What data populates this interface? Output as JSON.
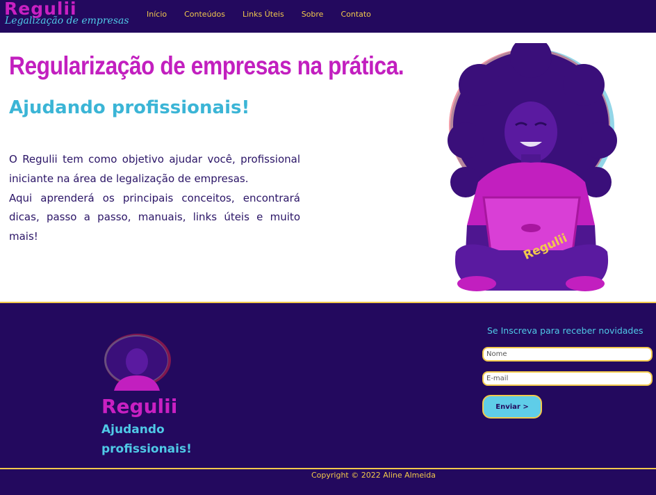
{
  "header": {
    "brand_title": "Regulii",
    "brand_subtitle": "Legalização de empresas",
    "nav": [
      {
        "label": "Início"
      },
      {
        "label": "Conteúdos"
      },
      {
        "label": "Links Úteis"
      },
      {
        "label": "Sobre"
      },
      {
        "label": "Contato"
      }
    ]
  },
  "hero": {
    "title": "Regularização de empresas na prática.",
    "subtitle": "Ajudando profissionais!",
    "paragraph_1": "O Regulii tem como objetivo ajudar você, profissional iniciante na área de legalização de empresas.",
    "paragraph_2": "Aqui aprenderá os principais conceitos, encontrará dicas, passo a passo, manuais, links úteis e muito mais!",
    "illustration_badge": "Regulii"
  },
  "footer": {
    "brand": "Regulii",
    "tagline": "Ajudando profissionais!",
    "subscribe_heading": "Se Inscreva para receber novidades",
    "name_placeholder": "Nome",
    "email_placeholder": "E-mail",
    "submit_label": "Enviar >",
    "copyright": "Copyright © 2022 Aline Almeida"
  },
  "colors": {
    "primary": "#23095e",
    "magenta": "#c920c2",
    "cyan": "#4fc9e6",
    "yellow": "#f2c94c"
  },
  "icons": [
    "woman-with-laptop-illustration",
    "footer-avatar-illustration"
  ]
}
